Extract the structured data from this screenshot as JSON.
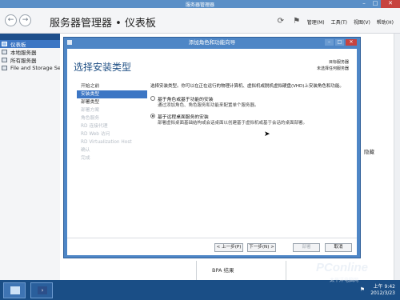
{
  "window": {
    "title": "服务器管理器"
  },
  "header": {
    "breadcrumb": "服务器管理器 • 仪表板",
    "menus": [
      "管理(M)",
      "工具(T)",
      "视图(V)",
      "帮助(H)"
    ]
  },
  "sidebar": {
    "items": [
      {
        "label": "仪表板"
      },
      {
        "label": "本地服务器"
      },
      {
        "label": "所有服务器"
      },
      {
        "label": "File and Storage Se"
      }
    ]
  },
  "main": {
    "hide_label": "隐藏",
    "bpa_label": "BPA 结果"
  },
  "dialog": {
    "title": "添加角色和功能向导",
    "heading": "选择安装类型",
    "dest_label": "目标服务器",
    "dest_server": "未选择任何服务器",
    "steps": [
      {
        "label": "开始之前",
        "state": "normal"
      },
      {
        "label": "安装类型",
        "state": "current"
      },
      {
        "label": "部署类型",
        "state": "normal"
      },
      {
        "label": "部署方案",
        "state": "disabled"
      },
      {
        "label": "角色服务",
        "state": "disabled"
      },
      {
        "label": "RD 连接代理",
        "state": "disabled"
      },
      {
        "label": "RD Web 访问",
        "state": "disabled"
      },
      {
        "label": "RD Virtualization Host",
        "state": "disabled"
      },
      {
        "label": "确认",
        "state": "disabled"
      },
      {
        "label": "完成",
        "state": "disabled"
      }
    ],
    "description": "选择安装类型。你可以在正在运行的物理计算机、虚拟机或脱机虚拟硬盘(VHD)上安装角色和功能。",
    "options": [
      {
        "title": "基于角色或基于功能的安装",
        "desc": "通过添加角色、角色服务和功能来配置单个服务器。",
        "checked": false
      },
      {
        "title": "基于远程桌面服务的安装",
        "desc": "部署虚拟桌面基础结构或会话桌面以创建基于虚拟机或基于会话的桌面部署。",
        "checked": true
      }
    ],
    "buttons": {
      "prev": "< 上一步(P)",
      "next": "下一步(N) >",
      "install": "部署",
      "cancel": "取消"
    }
  },
  "taskbar": {
    "time": "上午 9:42",
    "date": "2012/3/23",
    "flag": "⚑"
  },
  "watermark": {
    "brand": "PConline",
    "sub": "太平洋电脑网"
  }
}
